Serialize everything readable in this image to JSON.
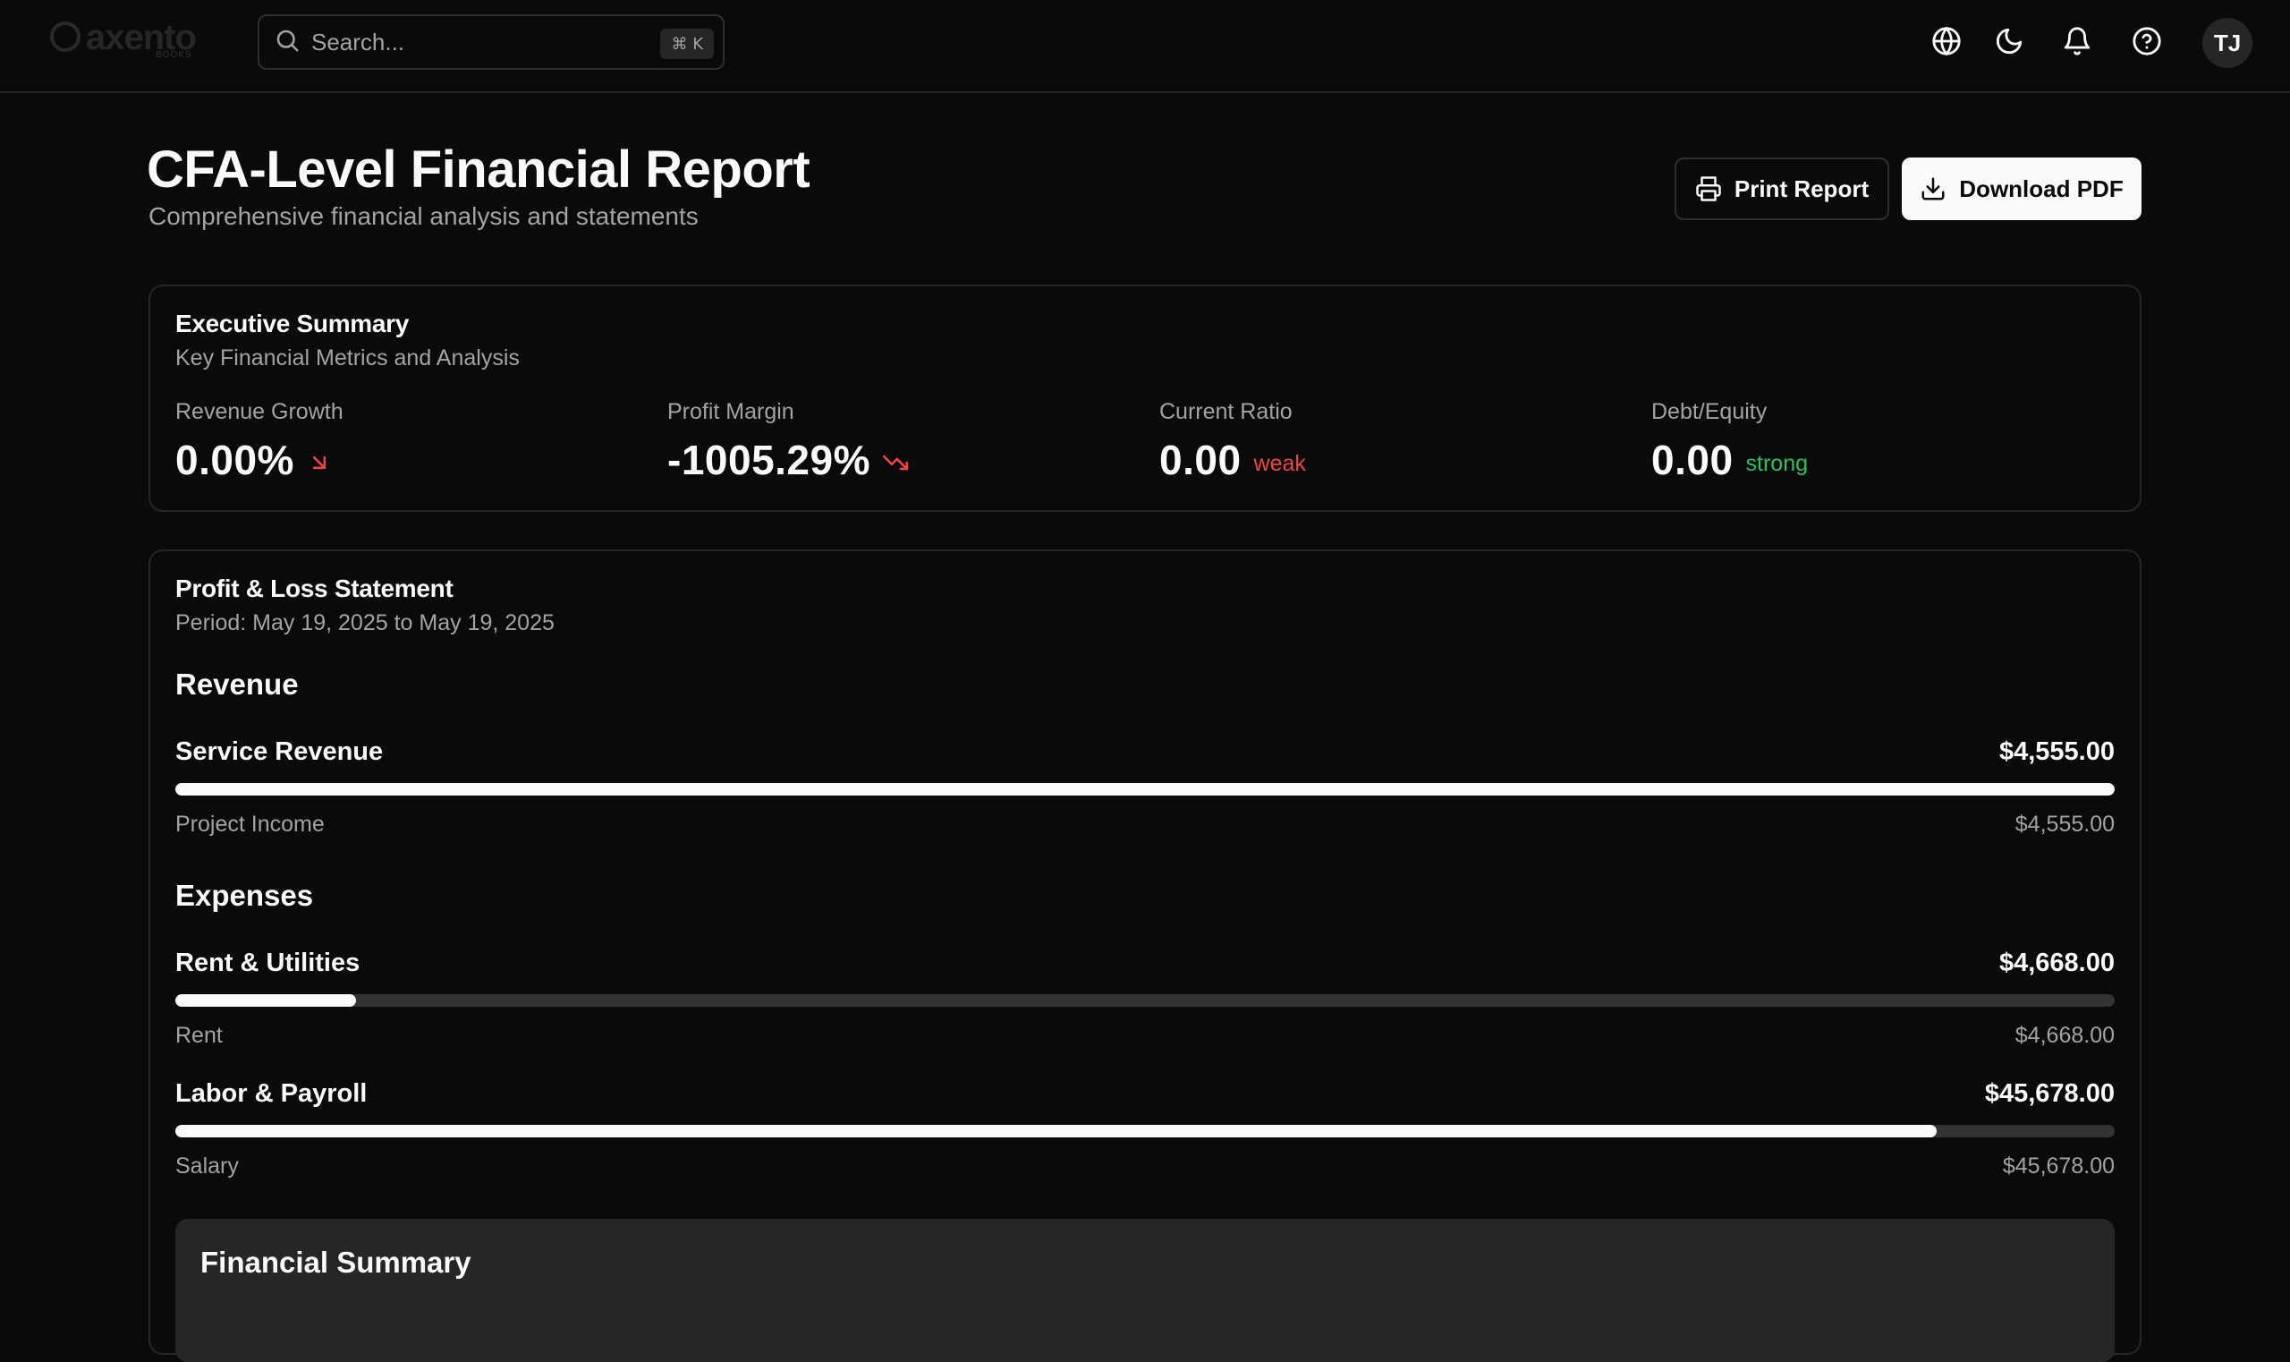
{
  "header": {
    "logo_text": "axento",
    "logo_sub": "BOOKS",
    "search": {
      "placeholder": "Search...",
      "shortcut": "⌘ K"
    },
    "icons": [
      "globe-icon",
      "moon-icon",
      "bell-icon",
      "help-circle-icon"
    ],
    "avatar_initials": "TJ"
  },
  "page": {
    "title": "CFA-Level Financial Report",
    "subtitle": "Comprehensive financial analysis and statements",
    "print_label": "Print Report",
    "download_label": "Download PDF"
  },
  "executive_summary": {
    "title": "Executive Summary",
    "description": "Key Financial Metrics and Analysis",
    "metrics": [
      {
        "label": "Revenue Growth",
        "value": "0.00%",
        "trend_icon": "arrow-down-right-icon",
        "trend_color": "#ef4444"
      },
      {
        "label": "Profit Margin",
        "value": "-1005.29%",
        "trend_icon": "trending-down-icon",
        "trend_color": "#ef4444"
      },
      {
        "label": "Current Ratio",
        "value": "0.00",
        "tag": "weak",
        "tag_color": "#ef4444"
      },
      {
        "label": "Debt/Equity",
        "value": "0.00",
        "tag": "strong",
        "tag_color": "#22c55e"
      }
    ]
  },
  "profit_loss": {
    "title": "Profit & Loss Statement",
    "period": "Period: May 19, 2025 to May 19, 2025",
    "revenue_heading": "Revenue",
    "expenses_heading": "Expenses",
    "revenue": [
      {
        "name": "Service Revenue",
        "amount": "$4,555.00",
        "fill_fraction": 1.0,
        "sub_name": "Project Income",
        "sub_amount": "$4,555.00"
      }
    ],
    "expenses": [
      {
        "name": "Rent & Utilities",
        "amount": "$4,668.00",
        "fill_fraction": 0.093,
        "sub_name": "Rent",
        "sub_amount": "$4,668.00"
      },
      {
        "name": "Labor & Payroll",
        "amount": "$45,678.00",
        "fill_fraction": 0.908,
        "sub_name": "Salary",
        "sub_amount": "$45,678.00"
      }
    ],
    "summary_title": "Financial Summary"
  },
  "colors": {
    "background": "#0a0a0a",
    "card_border": "#262626",
    "muted": "#a3a3a3",
    "negative": "#ef4444",
    "positive": "#22c55e"
  }
}
